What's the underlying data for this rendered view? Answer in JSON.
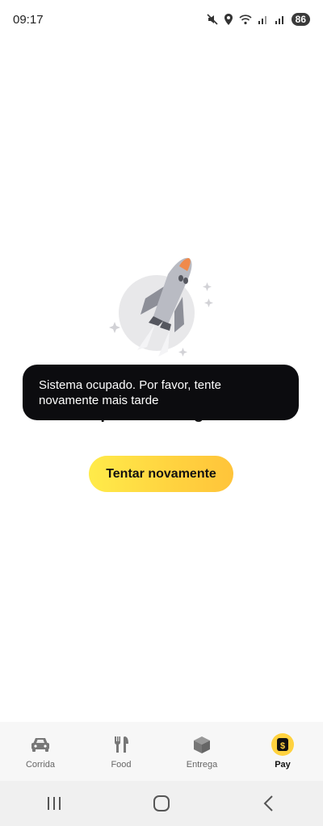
{
  "status_bar": {
    "time": "09:17",
    "battery": "86",
    "icons": [
      "mute-icon",
      "location-icon",
      "wifi-icon",
      "signal-icon",
      "signal-icon"
    ]
  },
  "page": {
    "partial_message": "para recarregar.",
    "retry_label": "Tentar novamente"
  },
  "toast": {
    "message": "Sistema ocupado. Por favor, tente novamente mais tarde"
  },
  "bottom_nav": {
    "items": [
      {
        "label": "Corrida",
        "icon": "car-icon",
        "active": false
      },
      {
        "label": "Food",
        "icon": "fork-knife-icon",
        "active": false
      },
      {
        "label": "Entrega",
        "icon": "box-icon",
        "active": false
      },
      {
        "label": "Pay",
        "icon": "wallet-dollar-icon",
        "active": true
      }
    ]
  },
  "colors": {
    "accent": "#ffd23f",
    "toast_bg": "#0c0c0f"
  }
}
